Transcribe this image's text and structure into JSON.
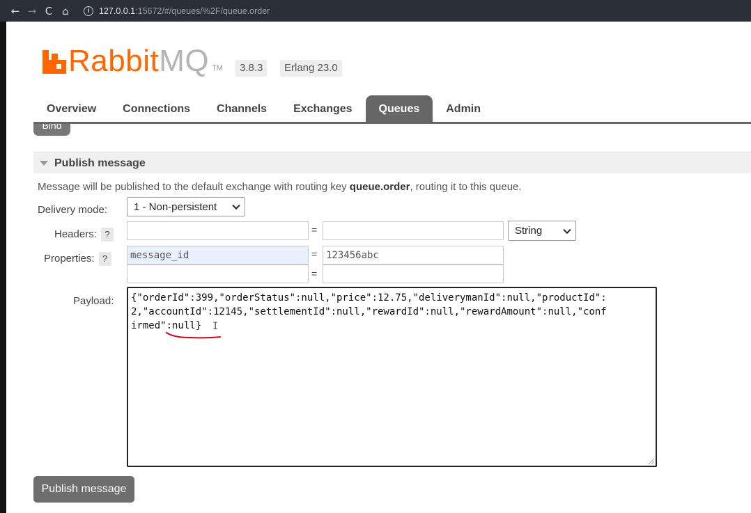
{
  "browser": {
    "back_glyph": "←",
    "forward_glyph": "→",
    "reload_glyph": "C",
    "home_glyph": "⌂",
    "info_glyph": "i",
    "url_host": "127.0.0.1",
    "url_rest": ":15672/#/queues/%2F/queue.order"
  },
  "header": {
    "logo_primary": "Rabbit",
    "logo_secondary": "MQ",
    "logo_tm": "TM",
    "version": "3.8.3",
    "erlang": "Erlang 23.0"
  },
  "tabs": [
    {
      "label": "Overview"
    },
    {
      "label": "Connections"
    },
    {
      "label": "Channels"
    },
    {
      "label": "Exchanges"
    },
    {
      "label": "Queues"
    },
    {
      "label": "Admin"
    }
  ],
  "bind_button": {
    "label": "Bind"
  },
  "publish": {
    "section_title": "Publish message",
    "description_pre": "Message will be published to the default exchange with routing key ",
    "routing_key": "queue.order",
    "description_post": ", routing it to this queue.",
    "delivery_mode_label": "Delivery mode:",
    "delivery_mode_value": "1 - Non-persistent",
    "headers_label": "Headers:",
    "help_glyph": "?",
    "equals": "=",
    "headers_type": "String",
    "properties_label": "Properties:",
    "property_key": "message_id",
    "property_value": "123456abc",
    "payload_label": "Payload:",
    "payload_lines": [
      "{\"orderId\":399,\"orderStatus\":null,\"price\":12.75,\"deliverymanId\":null,\"productId\":",
      "2,\"accountId\":12145,\"settlementId\":null,\"rewardId\":null,\"rewardAmount\":null,\"conf",
      "irmed\":null}"
    ],
    "cursor_glyph": "I",
    "button_label": "Publish message"
  },
  "colors": {
    "brand_orange": "#ff6600",
    "tab_active": "#666666",
    "annotation_red": "#d0021b"
  }
}
